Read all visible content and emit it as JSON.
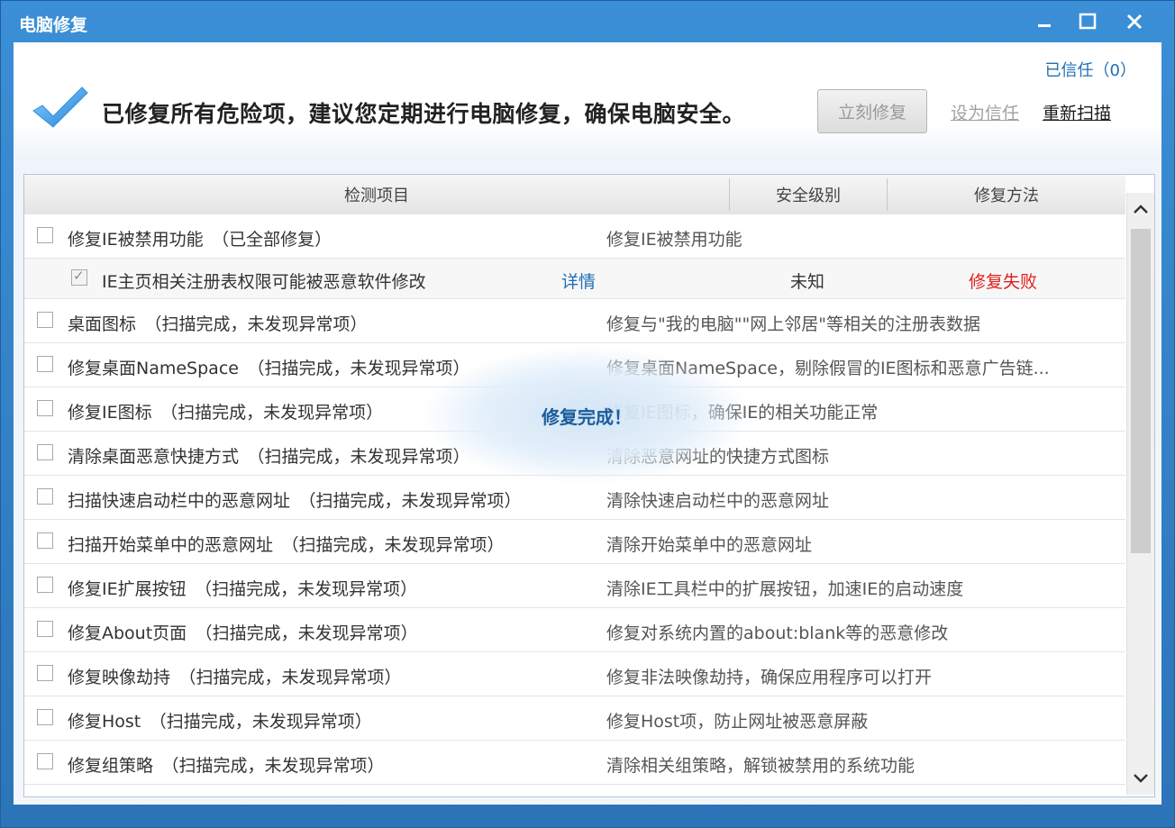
{
  "window": {
    "title": "电脑修复"
  },
  "header": {
    "trusted_link": "已信任（0）",
    "status_message": "已修复所有危险项，建议您定期进行电脑修复，确保电脑安全。",
    "fix_now_label": "立刻修复",
    "set_trust_label": "设为信任",
    "rescan_label": "重新扫描"
  },
  "table": {
    "columns": [
      "检测项目",
      "安全级别",
      "修复方法"
    ],
    "rows": [
      {
        "name": "修复IE被禁用功能　（已全部修复）",
        "method": "修复IE被禁用功能",
        "checked": false
      },
      {
        "name": "桌面图标　（扫描完成，未发现异常项）",
        "method": "修复与\"我的电脑\"\"网上邻居\"等相关的注册表数据",
        "checked": false
      },
      {
        "name": "修复桌面NameSpace　（扫描完成，未发现异常项）",
        "method": "修复桌面NameSpace，剔除假冒的IE图标和恶意广告链...",
        "checked": false
      },
      {
        "name": "修复IE图标　（扫描完成，未发现异常项）",
        "method": "修复IE图标，确保IE的相关功能正常",
        "checked": false
      },
      {
        "name": "清除桌面恶意快捷方式　（扫描完成，未发现异常项）",
        "method": "清除恶意网址的快捷方式图标",
        "checked": false
      },
      {
        "name": "扫描快速启动栏中的恶意网址　（扫描完成，未发现异常项）",
        "method": "清除快速启动栏中的恶意网址",
        "checked": false
      },
      {
        "name": "扫描开始菜单中的恶意网址　（扫描完成，未发现异常项）",
        "method": "清除开始菜单中的恶意网址",
        "checked": false
      },
      {
        "name": "修复IE扩展按钮　（扫描完成，未发现异常项）",
        "method": "清除IE工具栏中的扩展按钮，加速IE的启动速度",
        "checked": false
      },
      {
        "name": "修复About页面　（扫描完成，未发现异常项）",
        "method": "修复对系统内置的about:blank等的恶意修改",
        "checked": false
      },
      {
        "name": "修复映像劫持　（扫描完成，未发现异常项）",
        "method": "修复非法映像劫持，确保应用程序可以打开",
        "checked": false
      },
      {
        "name": "修复Host　（扫描完成，未发现异常项）",
        "method": "修复Host项，防止网址被恶意屏蔽",
        "checked": false
      },
      {
        "name": "修复组策略　（扫描完成，未发现异常项）",
        "method": "清除相关组策略，解锁被禁用的系统功能",
        "checked": false
      }
    ],
    "sub_row": {
      "name": "IE主页相关注册表权限可能被恶意软件修改",
      "detail_label": "详情",
      "level": "未知",
      "result": "修复失败",
      "checked": true
    }
  },
  "toast": {
    "message": "修复完成！"
  }
}
